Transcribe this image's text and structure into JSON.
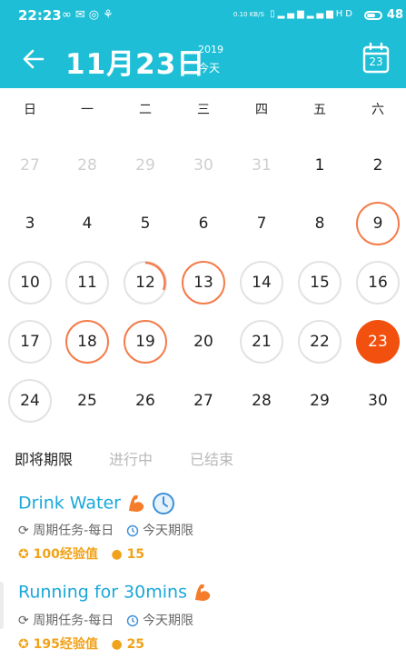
{
  "status_bar": {
    "time": "22:23",
    "speed": "0.10 KB/S",
    "battery": "48",
    "left_icons": [
      "infinity-icon",
      "message-icon",
      "hotspot-icon",
      "link-icon"
    ],
    "right_icons": [
      "vibrate-icon",
      "signal-icon",
      "signal-icon",
      "hd-icon"
    ]
  },
  "header": {
    "title": "11月23日",
    "year": "2019",
    "today_label": "今天",
    "calendar_icon_day": "23",
    "accent_color": "#1ebfd6"
  },
  "weekdays": [
    "日",
    "一",
    "二",
    "三",
    "四",
    "五",
    "六"
  ],
  "calendar_days": [
    {
      "day": "27",
      "state": "muted"
    },
    {
      "day": "28",
      "state": "muted"
    },
    {
      "day": "29",
      "state": "muted"
    },
    {
      "day": "30",
      "state": "muted"
    },
    {
      "day": "31",
      "state": "muted"
    },
    {
      "day": "1",
      "state": "plain"
    },
    {
      "day": "2",
      "state": "plain"
    },
    {
      "day": "3",
      "state": "plain"
    },
    {
      "day": "4",
      "state": "plain"
    },
    {
      "day": "5",
      "state": "plain"
    },
    {
      "day": "6",
      "state": "plain"
    },
    {
      "day": "7",
      "state": "plain"
    },
    {
      "day": "8",
      "state": "plain"
    },
    {
      "day": "9",
      "state": "done"
    },
    {
      "day": "10",
      "state": "ring"
    },
    {
      "day": "11",
      "state": "ring"
    },
    {
      "day": "12",
      "state": "partial"
    },
    {
      "day": "13",
      "state": "done"
    },
    {
      "day": "14",
      "state": "ring"
    },
    {
      "day": "15",
      "state": "ring"
    },
    {
      "day": "16",
      "state": "ring"
    },
    {
      "day": "17",
      "state": "ring"
    },
    {
      "day": "18",
      "state": "done"
    },
    {
      "day": "19",
      "state": "done"
    },
    {
      "day": "20",
      "state": "plain"
    },
    {
      "day": "21",
      "state": "ring"
    },
    {
      "day": "22",
      "state": "ring"
    },
    {
      "day": "23",
      "state": "today"
    },
    {
      "day": "24",
      "state": "ring"
    },
    {
      "day": "25",
      "state": "plain"
    },
    {
      "day": "26",
      "state": "plain"
    },
    {
      "day": "27",
      "state": "plain"
    },
    {
      "day": "28",
      "state": "plain"
    },
    {
      "day": "29",
      "state": "plain"
    },
    {
      "day": "30",
      "state": "plain"
    }
  ],
  "tabs": [
    {
      "label": "即将期限",
      "active": true
    },
    {
      "label": "进行中",
      "active": false
    },
    {
      "label": "已结束",
      "active": false
    }
  ],
  "tasks": [
    {
      "name": "Drink Water",
      "period": "周期任务-每日",
      "deadline": "今天期限",
      "xp": "100经验值",
      "coins": "15",
      "icons": [
        "muscle-icon",
        "clock-icon"
      ]
    },
    {
      "name": "Running for 30mins",
      "period": "周期任务-每日",
      "deadline": "今天期限",
      "xp": "195经验值",
      "coins": "25",
      "icons": [
        "muscle-icon"
      ]
    }
  ],
  "colors": {
    "done_ring": "#f47c4a",
    "today_fill": "#f2500f",
    "task_name": "#1aa8d9",
    "reward": "#f0a21a"
  }
}
